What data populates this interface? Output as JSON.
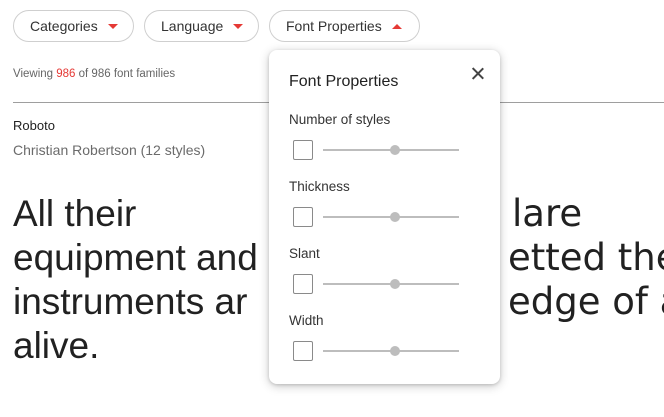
{
  "filters": {
    "categories_label": "Categories",
    "language_label": "Language",
    "font_properties_label": "Font Properties"
  },
  "results": {
    "viewing_prefix": "Viewing ",
    "viewing_count": "986",
    "viewing_suffix": " of 986 font families"
  },
  "font_card": {
    "name": "Roboto",
    "author": "Christian Robertson (12 styles)",
    "sample_lines": [
      "All their",
      "equipment and",
      "instruments ar",
      "alive."
    ],
    "sample_right_lines": [
      "lare",
      "etted the",
      "edge of a",
      ""
    ]
  },
  "popup": {
    "title": "Font Properties",
    "properties": [
      {
        "label": "Number of styles"
      },
      {
        "label": "Thickness"
      },
      {
        "label": "Slant"
      },
      {
        "label": "Width"
      }
    ]
  },
  "colors": {
    "accent": "#e53935",
    "text_primary": "#212121",
    "text_secondary": "#6b6b6b"
  }
}
